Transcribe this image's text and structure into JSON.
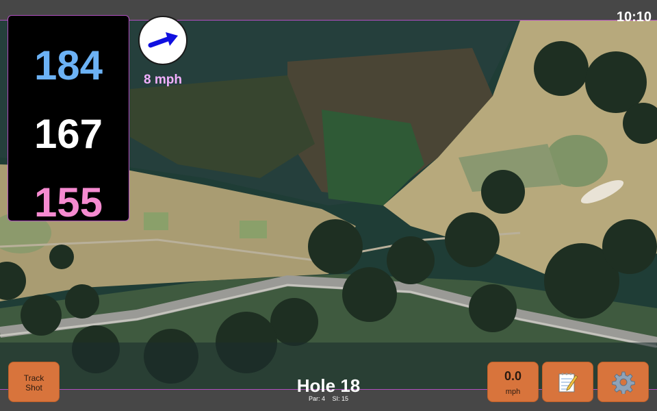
{
  "status": {
    "time": "10:10"
  },
  "distances": {
    "back": "184",
    "middle": "167",
    "front": "155"
  },
  "wind": {
    "speed": "8 mph",
    "direction_icon": "wind-arrow-icon"
  },
  "hole": {
    "title": "Hole 18",
    "par": "Par: 4",
    "stroke_index": "SI: 15"
  },
  "buttons": {
    "track_shot": [
      "Track",
      "Shot"
    ],
    "speed_value": "0.0",
    "speed_unit": "mph",
    "notes_icon": "notepad-icon",
    "settings_icon": "gear-icon"
  },
  "colors": {
    "accent_border": "#b04fc0",
    "back_distance": "#6cb2f5",
    "middle_distance": "#ffffff",
    "front_distance": "#f58ad0",
    "button": "#d8743c",
    "wind_text": "#f2b0ff"
  }
}
